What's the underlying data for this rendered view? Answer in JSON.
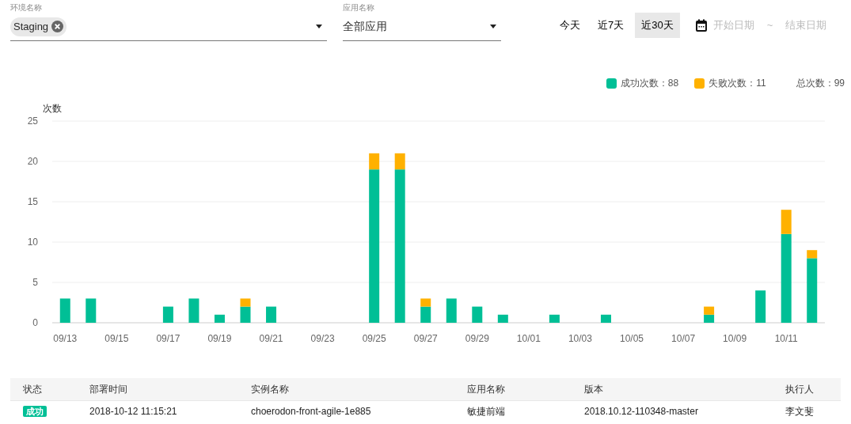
{
  "filters": [
    {
      "label": "环境名称",
      "chips": [
        "Staging"
      ]
    },
    {
      "label": "应用名称",
      "value": "全部应用"
    }
  ],
  "quick_ranges": [
    {
      "label": "今天",
      "selected": false
    },
    {
      "label": "近7天",
      "selected": false
    },
    {
      "label": "近30天",
      "selected": true
    }
  ],
  "date_range": {
    "start_placeholder": "开始日期",
    "separator": "~",
    "end_placeholder": "结束日期"
  },
  "legend": [
    {
      "label": "成功次数：88",
      "color": "#00bf96"
    },
    {
      "label": "失败次数：11",
      "color": "#ffb100"
    }
  ],
  "total": "总次数：99",
  "chart": {
    "chart_data": {
      "type": "bar",
      "stacked": true,
      "ylabel": "次数",
      "ylim": [
        0,
        25
      ],
      "yticks": [
        0,
        5,
        10,
        15,
        20,
        25
      ],
      "grid": true,
      "categories": [
        "09/13",
        null,
        "09/15",
        null,
        "09/17",
        null,
        "09/19",
        null,
        "09/21",
        null,
        "09/23",
        null,
        "09/25",
        null,
        "09/27",
        null,
        "09/29",
        null,
        "10/01",
        null,
        "10/03",
        null,
        "10/05",
        null,
        "10/07",
        null,
        "10/09",
        null,
        "10/11",
        null
      ],
      "series": [
        {
          "color": "#00bf96",
          "values": [
            3,
            3,
            0,
            0,
            2,
            3,
            1,
            2,
            2,
            0,
            0,
            0,
            19,
            19,
            2,
            3,
            2,
            1,
            0,
            1,
            0,
            1,
            0,
            0,
            0,
            1,
            0,
            4,
            11,
            8
          ]
        },
        {
          "color": "#ffb100",
          "values": [
            0,
            0,
            0,
            0,
            0,
            0,
            0,
            1,
            0,
            0,
            0,
            0,
            2,
            2,
            1,
            0,
            0,
            0,
            0,
            0,
            0,
            0,
            0,
            0,
            0,
            1,
            0,
            0,
            3,
            1
          ]
        }
      ]
    }
  },
  "table": {
    "columns": [
      "状态",
      "部署时间",
      "实例名称",
      "应用名称",
      "版本",
      "执行人"
    ],
    "rows": [
      {
        "cells": [
          "成功",
          "2018-10-12 11:15:21",
          "choerodon-front-agile-1e885",
          "敏捷前端",
          "2018.10.12-110348-master",
          "李文斐"
        ]
      }
    ]
  }
}
